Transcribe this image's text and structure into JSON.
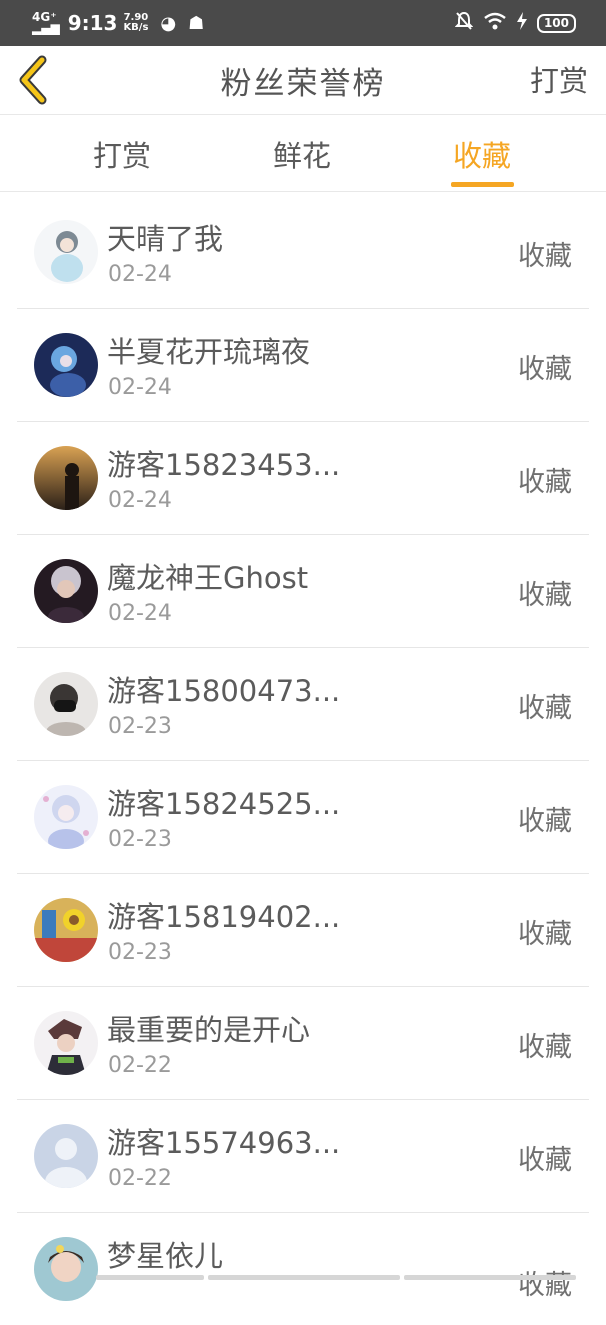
{
  "status_bar": {
    "network": "4G⁺",
    "signal": "▂▄▆",
    "time": "9:13",
    "speed_value": "7.90",
    "speed_unit": "KB/s",
    "battery": "100"
  },
  "header": {
    "title": "粉丝荣誉榜",
    "right_action": "打赏"
  },
  "tabs": [
    {
      "label": "打赏",
      "active": false
    },
    {
      "label": "鲜花",
      "active": false
    },
    {
      "label": "收藏",
      "active": true
    }
  ],
  "accent_color": "#f5a623",
  "fans": [
    {
      "name": "天晴了我",
      "date": "02-24",
      "action": "收藏",
      "avatar": "anime-girl-avatar"
    },
    {
      "name": "半夏花开琉璃夜",
      "date": "02-24",
      "action": "收藏",
      "avatar": "blue-anime-avatar"
    },
    {
      "name": "游客15823453...",
      "date": "02-24",
      "action": "收藏",
      "avatar": "sunset-avatar"
    },
    {
      "name": "魔龙神王Ghost",
      "date": "02-24",
      "action": "收藏",
      "avatar": "dark-anime-avatar"
    },
    {
      "name": "游客15800473...",
      "date": "02-23",
      "action": "收藏",
      "avatar": "masked-person-avatar"
    },
    {
      "name": "游客15824525...",
      "date": "02-23",
      "action": "收藏",
      "avatar": "white-anime-avatar"
    },
    {
      "name": "游客15819402...",
      "date": "02-23",
      "action": "收藏",
      "avatar": "toy-avatar"
    },
    {
      "name": "最重要的是开心",
      "date": "02-22",
      "action": "收藏",
      "avatar": "boy-anime-avatar"
    },
    {
      "name": "游客15574963...",
      "date": "02-22",
      "action": "收藏",
      "avatar": "default-avatar"
    },
    {
      "name": "梦星依儿",
      "date": "",
      "action": "收藏",
      "avatar": "girl-photo-avatar"
    }
  ]
}
